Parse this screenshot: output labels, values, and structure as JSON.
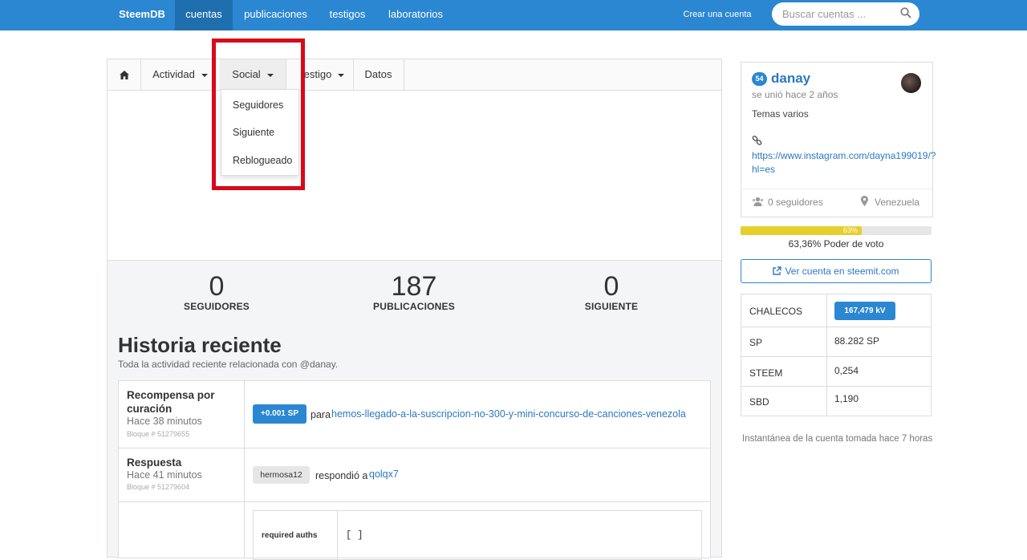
{
  "nav": {
    "brand": "SteemDB",
    "items": [
      "cuentas",
      "publicaciones",
      "testigos",
      "laboratorios"
    ],
    "create_account": "Crear una cuenta",
    "search_placeholder": "Buscar cuentas ..."
  },
  "tabs": {
    "activity": "Actividad",
    "social": "Social",
    "witness_partial": "estigo",
    "data": "Datos"
  },
  "social_menu": [
    "Seguidores",
    "Siguiente",
    "Reblogueado"
  ],
  "stats": [
    {
      "value": "0",
      "label": "SEGUIDORES"
    },
    {
      "value": "187",
      "label": "PUBLICACIONES"
    },
    {
      "value": "0",
      "label": "SIGUIENTE"
    }
  ],
  "history": {
    "title": "Historia reciente",
    "subtitle": "Toda la actividad reciente relacionada con @danay.",
    "rows": [
      {
        "title": "Recompensa por curación",
        "time": "Hace 38 minutos",
        "block": "Bloque # 51279655",
        "badge": "+0.001 SP",
        "connector": "para",
        "link": "hemos-llegado-a-la-suscripcion-no-300-y-mini-concurso-de-canciones-venezola"
      },
      {
        "title": "Respuesta",
        "time": "Hace 41 minutos",
        "block": "Bloque # 51279604",
        "badge": "hermosa12",
        "connector": "respondió a",
        "link": "qolqx7"
      }
    ],
    "auth_label": "required auths",
    "auth_value": "[ ]"
  },
  "profile": {
    "reputation": "54",
    "username": "danay",
    "joined": "se unió hace 2 años",
    "about": "Temas varios",
    "url_line1": "https://www.instagram.com/dayna199019/?",
    "url_line2": "hl=es",
    "followers": "0 seguidores",
    "location": "Venezuela"
  },
  "voting_power": {
    "percent": 63.36,
    "bar_label": "63%",
    "label": "63,36% Poder de voto"
  },
  "steemit_button": "Ver cuenta en steemit.com",
  "wallet": [
    {
      "label": "CHALECOS",
      "value": "167,479 kV"
    },
    {
      "label": "SP",
      "value": "88.282 SP"
    },
    {
      "label": "STEEM",
      "value": "0,254"
    },
    {
      "label": "SBD",
      "value": "1,190"
    }
  ],
  "snapshot": "Instantánea de la cuenta tomada hace 7 horas",
  "colors": {
    "primary": "#2b87d1",
    "nav_active": "#1f6fae",
    "highlight_red": "#d7091a",
    "vote_yellow": "#e5cf2c"
  }
}
